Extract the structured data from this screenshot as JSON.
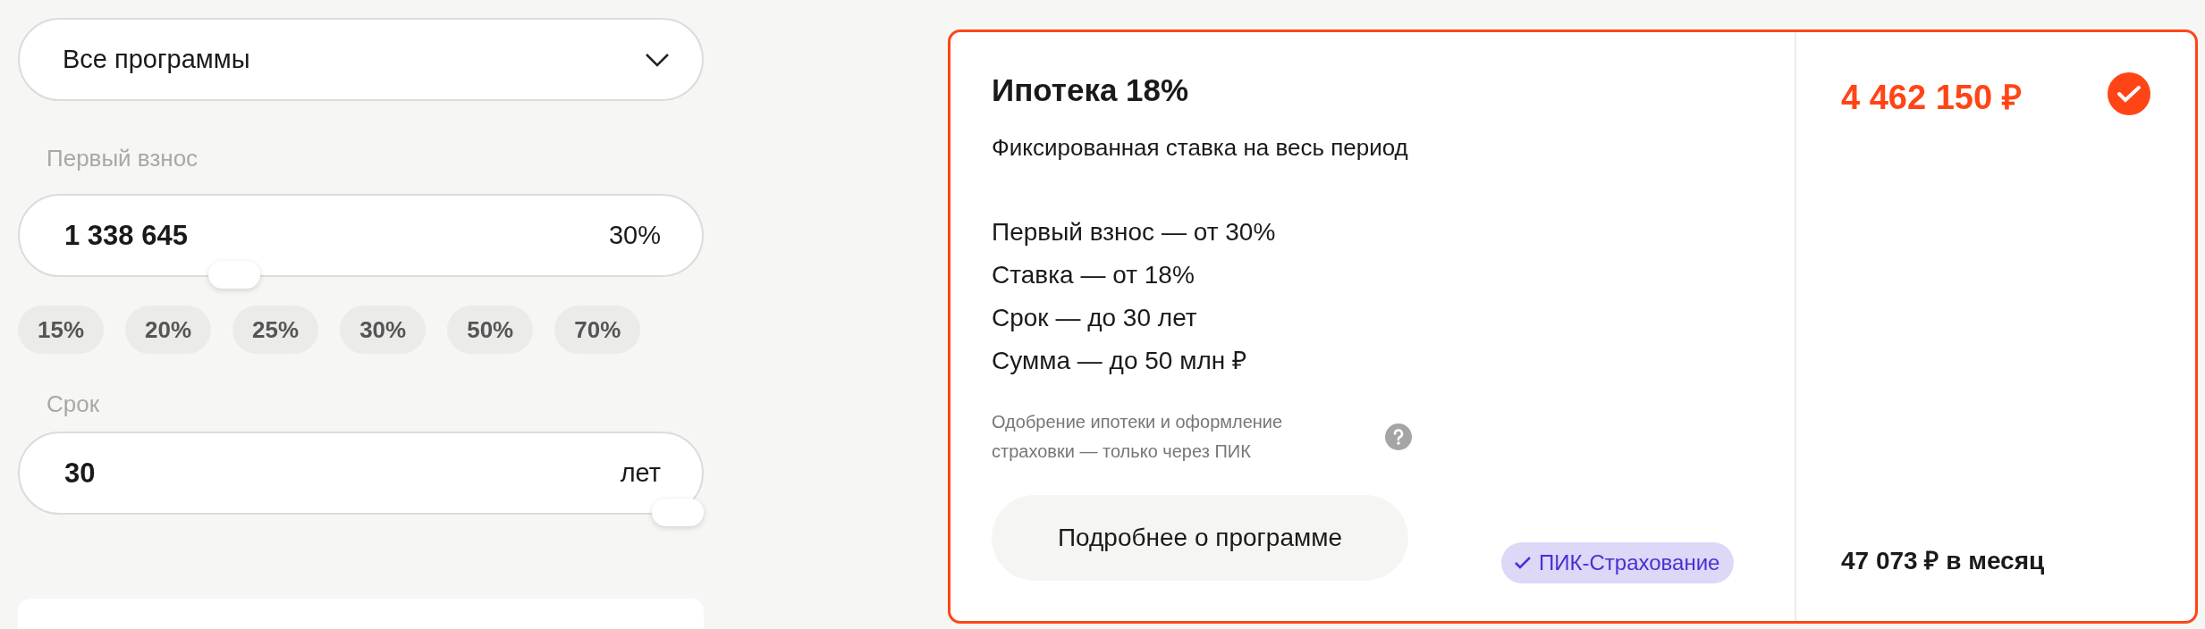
{
  "program_select": {
    "value": "Все программы"
  },
  "down_payment": {
    "label": "Первый взнос",
    "value": "1 338 645",
    "suffix": "30%",
    "level": 0.3
  },
  "down_payment_presets": [
    {
      "label": "15%"
    },
    {
      "label": "20%"
    },
    {
      "label": "25%"
    },
    {
      "label": "30%"
    },
    {
      "label": "50%"
    },
    {
      "label": "70%"
    }
  ],
  "term": {
    "label": "Срок",
    "value": "30",
    "suffix": "лет",
    "level": 1
  },
  "program_card": {
    "selected": true,
    "title": "Ипотека 18%",
    "subtitle": "Фиксированная ставка на весь период",
    "conditions": [
      "Первый взнос — от 30%",
      "Ставка — от 18%",
      "Срок — до 30 лет",
      "Сумма — до 50 млн ₽"
    ],
    "note": "Одобрение ипотеки и оформление страховки — только через ПИК",
    "details_button": "Подробнее о программе",
    "badge": "ПИК-Страхование",
    "total": "4 462 150 ₽",
    "monthly": "47 073 ₽ в месяц"
  }
}
